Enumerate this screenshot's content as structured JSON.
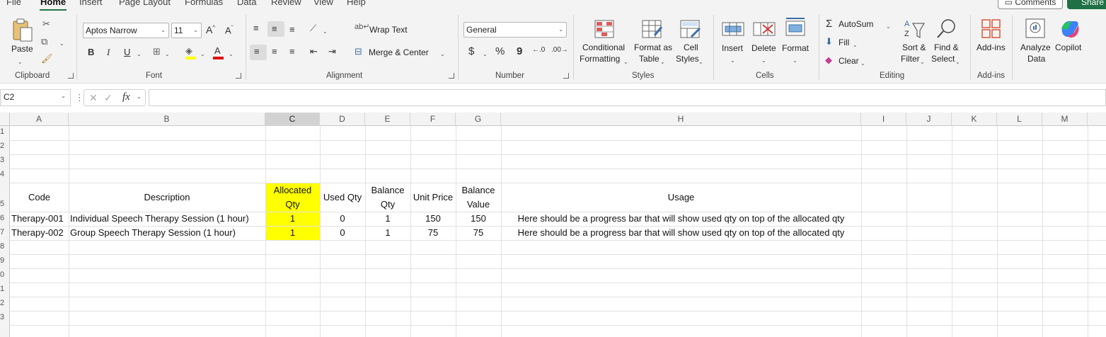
{
  "tabs": [
    "File",
    "Home",
    "Insert",
    "Page Layout",
    "Formulas",
    "Data",
    "Review",
    "View",
    "Help"
  ],
  "top_right": {
    "comments": "Comments",
    "share": "Share"
  },
  "ribbon": {
    "clipboard": {
      "paste": "Paste",
      "group": "Clipboard"
    },
    "font": {
      "name": "Aptos Narrow",
      "size": "11",
      "group": "Font",
      "bold": "B",
      "italic": "I",
      "underline": "U",
      "grow": "A^",
      "shrink": "Aˇ"
    },
    "alignment": {
      "wrap_text": "Wrap Text",
      "merge_center": "Merge & Center",
      "group": "Alignment"
    },
    "number": {
      "format": "General",
      "currency": "$",
      "percent": "%",
      "comma": "9",
      "group": "Number"
    },
    "styles": {
      "conditional_1": "Conditional",
      "conditional_2": "Formatting",
      "format_table_1": "Format as",
      "format_table_2": "Table",
      "cell_styles_1": "Cell",
      "cell_styles_2": "Styles",
      "group": "Styles"
    },
    "cells": {
      "insert": "Insert",
      "delete": "Delete",
      "format": "Format",
      "group": "Cells"
    },
    "editing": {
      "autosum": "AutoSum",
      "fill": "Fill",
      "clear": "Clear",
      "sort_1": "Sort &",
      "sort_2": "Filter",
      "find_1": "Find &",
      "find_2": "Select",
      "group": "Editing"
    },
    "addins": {
      "addins": "Add-ins",
      "group": "Add-ins"
    },
    "analyze": {
      "line1": "Analyze",
      "line2": "Data"
    },
    "copilot": {
      "label": "Copilot"
    }
  },
  "formula_bar": {
    "name_box": "C2",
    "fx": "fx",
    "value": ""
  },
  "columns": [
    "A",
    "B",
    "C",
    "D",
    "E",
    "F",
    "G",
    "H",
    "I",
    "J",
    "K",
    "L",
    "M"
  ],
  "rows": [
    "1",
    "2",
    "3",
    "4",
    "5",
    "6",
    "7",
    "8",
    "9",
    "0",
    "1",
    "2",
    "3"
  ],
  "headers": {
    "code": "Code",
    "description": "Description",
    "allocated_1": "Allocated",
    "allocated_2": "Qty",
    "used": "Used Qty",
    "balance_1": "Balance",
    "balance_2": "Qty",
    "unit_price": "Unit Price",
    "balance_value_1": "Balance",
    "balance_value_2": "Value",
    "usage": "Usage"
  },
  "data_rows": [
    {
      "code": "Therapy-001",
      "description": "Individual Speech Therapy Session (1 hour)",
      "allocated": "1",
      "used": "0",
      "balance": "1",
      "unit_price": "150",
      "balance_value": "150",
      "usage": "Here should be a progress bar that will show used qty on top of the allocated qty"
    },
    {
      "code": "Therapy-002",
      "description": "Group Speech Therapy Session (1 hour)",
      "allocated": "1",
      "used": "0",
      "balance": "1",
      "unit_price": "75",
      "balance_value": "75",
      "usage": "Here should be a progress bar that will show used qty on top of the allocated qty"
    }
  ],
  "colors": {
    "highlight": "#ffff00",
    "accent": "#217346"
  }
}
